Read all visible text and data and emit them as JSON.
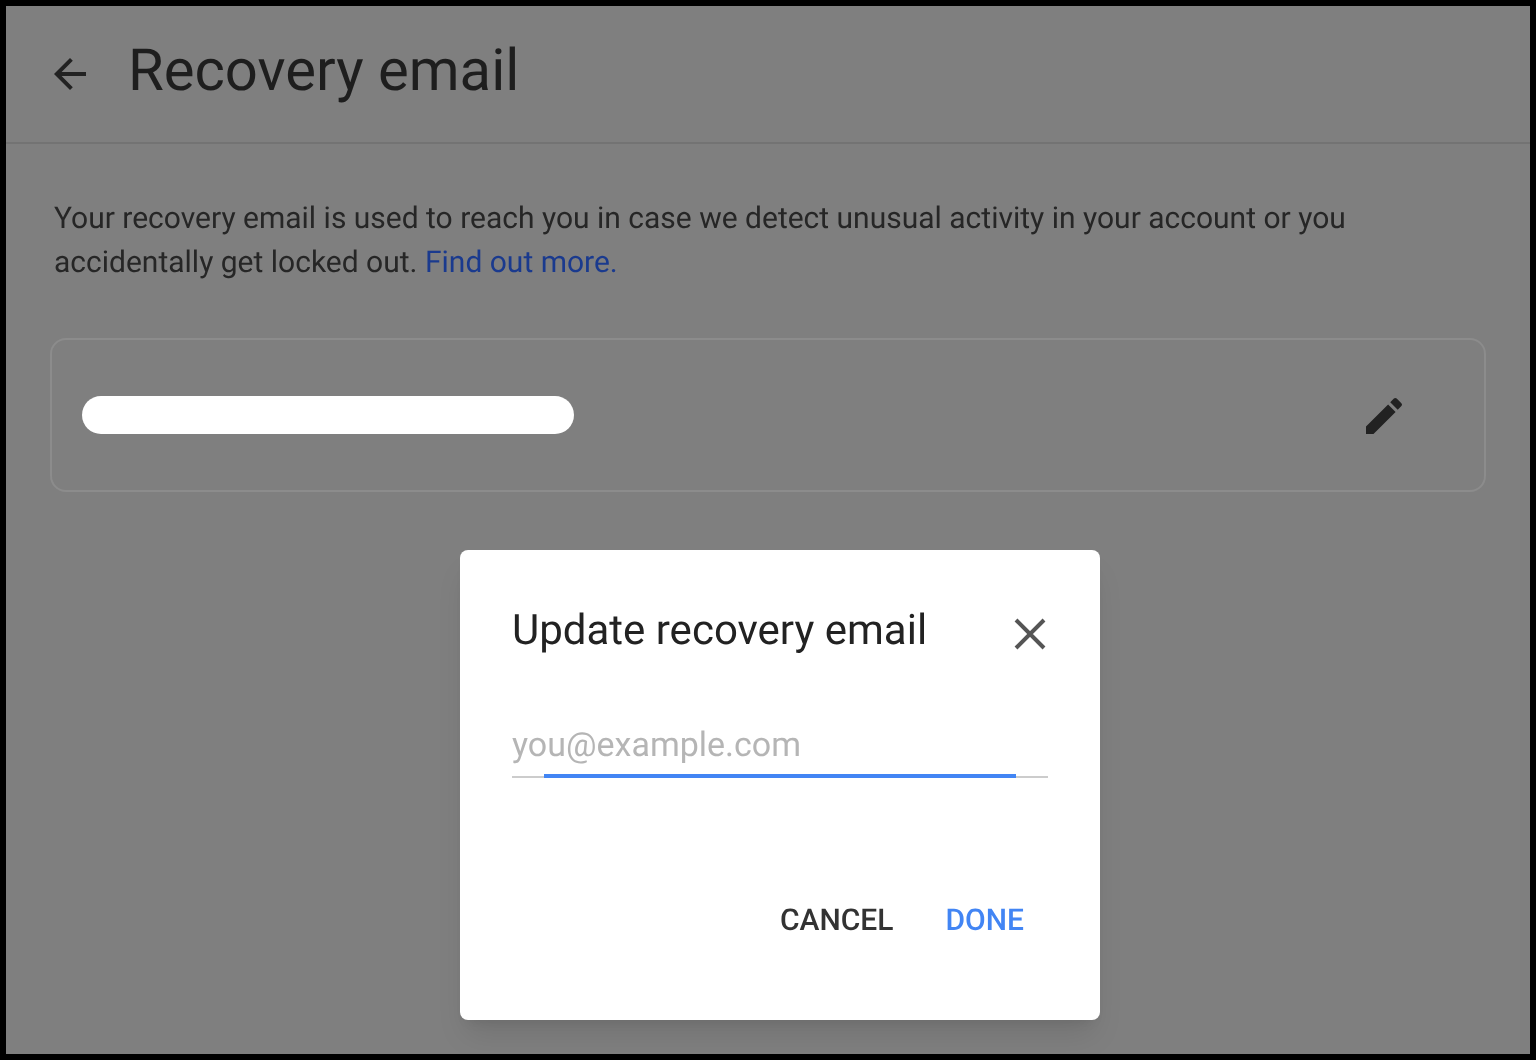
{
  "header": {
    "title": "Recovery email"
  },
  "description": {
    "text": "Your recovery email is used to reach you in case we detect unusual activity in your account or you accidentally get locked out.",
    "link": "Find out more."
  },
  "email_card": {
    "redacted": true
  },
  "dialog": {
    "title": "Update recovery email",
    "field": {
      "placeholder": "you@example.com",
      "focused": true
    },
    "buttons": [
      {
        "label": "CANCEL",
        "kind": "secondary"
      },
      {
        "label": "DONE",
        "kind": "primary"
      }
    ]
  }
}
